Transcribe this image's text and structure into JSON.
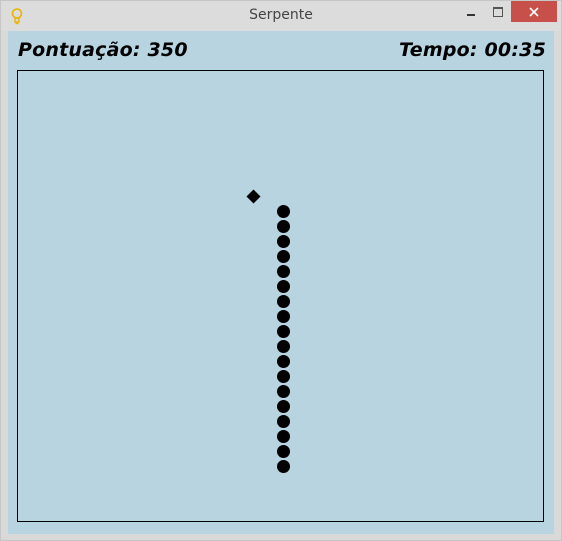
{
  "window": {
    "title": "Serpente",
    "minimize_icon": "minimize-icon",
    "maximize_icon": "maximize-icon",
    "close_icon": "close-icon",
    "app_icon": "lightbulb-icon",
    "close_color": "#c7504a"
  },
  "hud": {
    "score_label": "Pontuação: 350",
    "time_label": "Tempo: 00:35"
  },
  "game": {
    "background_color": "#b7d4e0",
    "snake_color": "#000000",
    "food_color": "#000000",
    "grid": {
      "cols": 35,
      "rows": 30
    },
    "food": {
      "col": 15,
      "row": 8
    },
    "snake_segments": [
      {
        "col": 17,
        "row": 9
      },
      {
        "col": 17,
        "row": 10
      },
      {
        "col": 17,
        "row": 11
      },
      {
        "col": 17,
        "row": 12
      },
      {
        "col": 17,
        "row": 13
      },
      {
        "col": 17,
        "row": 14
      },
      {
        "col": 17,
        "row": 15
      },
      {
        "col": 17,
        "row": 16
      },
      {
        "col": 17,
        "row": 17
      },
      {
        "col": 17,
        "row": 18
      },
      {
        "col": 17,
        "row": 19
      },
      {
        "col": 17,
        "row": 20
      },
      {
        "col": 17,
        "row": 21
      },
      {
        "col": 17,
        "row": 22
      },
      {
        "col": 17,
        "row": 23
      },
      {
        "col": 17,
        "row": 24
      },
      {
        "col": 17,
        "row": 25
      },
      {
        "col": 17,
        "row": 26
      }
    ]
  }
}
